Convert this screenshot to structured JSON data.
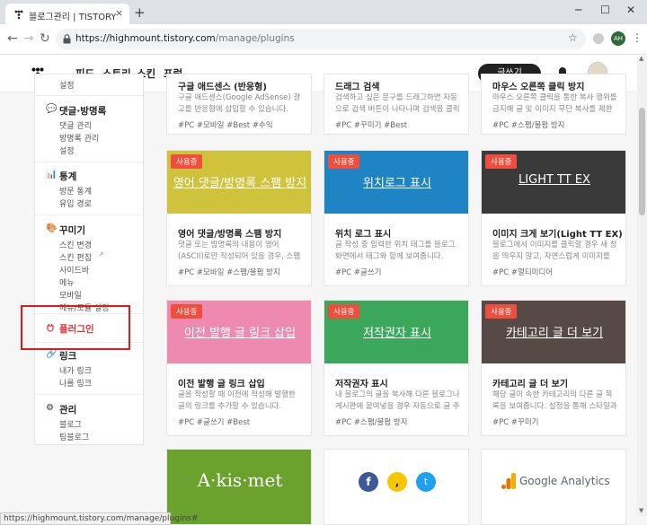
{
  "browser": {
    "tab_title": "블로그관리 | TISTORY",
    "tab_close": "×",
    "new_tab": "+",
    "url_host": "https://highmount.tistory.com",
    "url_path": "/manage/plugins",
    "profile_initials": "AH",
    "status_url": "https://highmount.tistory.com/manage/plugins#"
  },
  "site": {
    "menu": [
      "피드",
      "스토리",
      "스킨",
      "포럼"
    ],
    "write_label": "글쓰기"
  },
  "sidebar": {
    "top_item": "설정",
    "sections": [
      {
        "title": "댓글·방명록",
        "items": [
          "댓글 관리",
          "방명록 관리",
          "설정"
        ]
      },
      {
        "title": "통계",
        "items": [
          "방문 통계",
          "유입 경로"
        ]
      },
      {
        "title": "꾸미기",
        "items": [
          "스킨 변경",
          "스킨 편집",
          "사이드바",
          "메뉴",
          "모바일",
          "메뉴/모듈 설정"
        ]
      },
      {
        "title": "플러그인",
        "items": []
      },
      {
        "title": "링크",
        "items": [
          "내가 링크",
          "나를 링크"
        ]
      },
      {
        "title": "관리",
        "items": [
          "블로그",
          "팀블로그"
        ]
      }
    ]
  },
  "plugins": {
    "badge": "사용중",
    "top_row": [
      {
        "title": "구글 애드센스 (반응형)",
        "desc": "구글 애드센스(Google AdSense) 광고를 반응형에 삽입할 수 있습니다.",
        "tags": "#PC  #모바일  #Best  #수익"
      },
      {
        "title": "드래그 검색",
        "desc": "검색하고 싶은 문구를 드래그하면 자동으로 검색 버튼이 나타나며 검색을 클릭하면 새창으...",
        "tags": "#PC  #꾸미기  #Best"
      },
      {
        "title": "마우스 오른쪽 클릭 방지",
        "desc": "마우스 오른쪽 클릭을 통한 복사 행위를 금지해 글 및 이미지 무단 복사를 제한합니다. 다만 ...",
        "tags": "#PC  #스팸/불펌 방지"
      }
    ],
    "row2": [
      {
        "thumb": "영어 댓글/방명록 스팸 방지",
        "title": "영어 댓글/방명록 스팸 방지",
        "desc": "댓글 또는 방명록의 내용이 영어(ASCII)로만 작성되어 있을 경우, 스팸으로 간주해 자동으로 ...",
        "tags": "#PC  #모바일  #스팸/불펌 방지",
        "color": "#cfc33b"
      },
      {
        "thumb": "위치로그 표시",
        "title": "위치 로그 표시",
        "desc": "글 작성 중 입력한 위치 태그를 블로그 화면에서 태그와 함께 보여줍니다.",
        "tags": "#PC  #글쓰기",
        "color": "#1e84c4"
      },
      {
        "thumb": "LIGHT TT EX",
        "title": "이미지 크게 보기(Light TT EX)",
        "desc": "블로그에서 이미지를 클릭할 경우 새 창을 띄우지 않고, 자연스럽게 이미지를 크게 볼 수 있...",
        "tags": "#PC  #멀티미디어",
        "color": "#3a3a3a"
      }
    ],
    "row3": [
      {
        "thumb": "이전 발행 글 링크 삽입",
        "title": "이전 발행 글 링크 삽입",
        "desc": "글을 작성할 때 이전에 작성해 발행한 글의 링크를 추가할 수 있습니다.",
        "tags": "#PC  #글쓰기  #Best",
        "color": "#ee8ab0"
      },
      {
        "thumb": "저작권자 표시",
        "title": "저작권자 표시",
        "desc": "내 블로그의 글을 복사해 다른 블로그나 게시판에 붙여넣을 경우 자동으로 글 주소와 블로그...",
        "tags": "#PC  #스팸/불펌 방지",
        "color": "#3aa75a"
      },
      {
        "thumb": "카테고리 글 더 보기",
        "title": "카테고리 글 더 보기",
        "desc": "해당 글이 속한 카테고리의 다른 글 목록을 보여줍니다. 설정을 통해 스타일과 표시 개수를 변...",
        "tags": "#PC  #꾸미기",
        "color": "#574a46"
      }
    ],
    "row4": [
      {
        "label": "A·kis·met",
        "color": "#6ba22d"
      },
      {
        "label": "",
        "color": "#ffffff"
      },
      {
        "label": "Google Analytics",
        "color": "#ffffff"
      }
    ]
  },
  "colors": {
    "accent": "#f04d3c",
    "highlight_box": "#e01b1b"
  }
}
